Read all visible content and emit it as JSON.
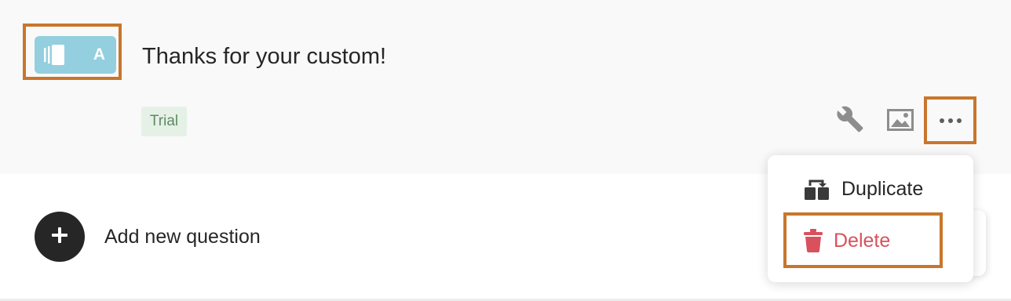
{
  "question": {
    "type_letter": "A",
    "type_icon": "card-stack-icon",
    "title": "Thanks for your custom!",
    "tag": "Trial"
  },
  "actions": {
    "settings_icon": "wrench-icon",
    "image_icon": "image-icon",
    "more_icon": "more-horizontal-icon"
  },
  "add_question": {
    "label": "Add new question",
    "icon": "plus-icon"
  },
  "menu": {
    "items": [
      {
        "label": "Duplicate",
        "icon": "duplicate-icon"
      },
      {
        "label": "Delete",
        "icon": "trash-icon",
        "color": "#d8515d"
      }
    ]
  },
  "colors": {
    "badge": "#93cfde",
    "highlight": "#c8762c",
    "tag_bg": "#e5f1e7",
    "tag_text": "#5d8a63",
    "danger": "#d8515d"
  }
}
